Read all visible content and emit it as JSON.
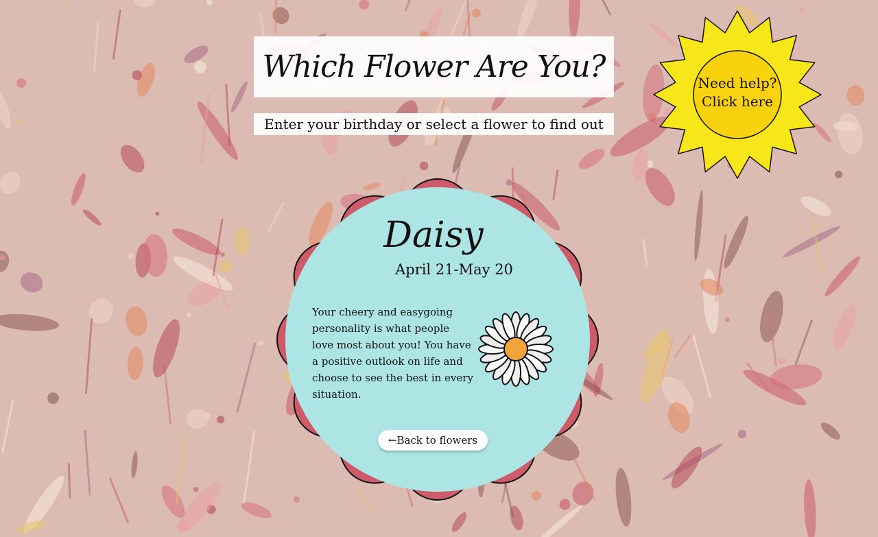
{
  "header": {
    "title": "Which Flower Are You?",
    "subtitle": "Enter your birthday or select a flower to find out"
  },
  "help": {
    "label_line1": "Need help?",
    "label_line2": "Click here"
  },
  "result": {
    "flower_name": "Daisy",
    "date_range": "April 21-May 20",
    "description": "Your cheery and easygoing personality is what people love most about you! You have a positive outlook on life and choose to see the best in every situation.",
    "back_button_label": "←Back to flowers",
    "icon": "daisy-icon"
  },
  "flower_wheel": {
    "petal_icons": [
      "lily-icon",
      "wildflower-icon",
      "lotus-icon",
      "rose-icon",
      "sunflower-icon",
      "hibiscus-icon",
      "poppy-icon",
      "fern-icon",
      "marigold-icon",
      "violet-icon",
      "carnation-icon",
      "orchid-icon"
    ]
  },
  "colors": {
    "petal": "#cd5b6a",
    "center_card": "#ade5e5",
    "sun": "#f6e61a",
    "background": "#d9b7ad"
  }
}
